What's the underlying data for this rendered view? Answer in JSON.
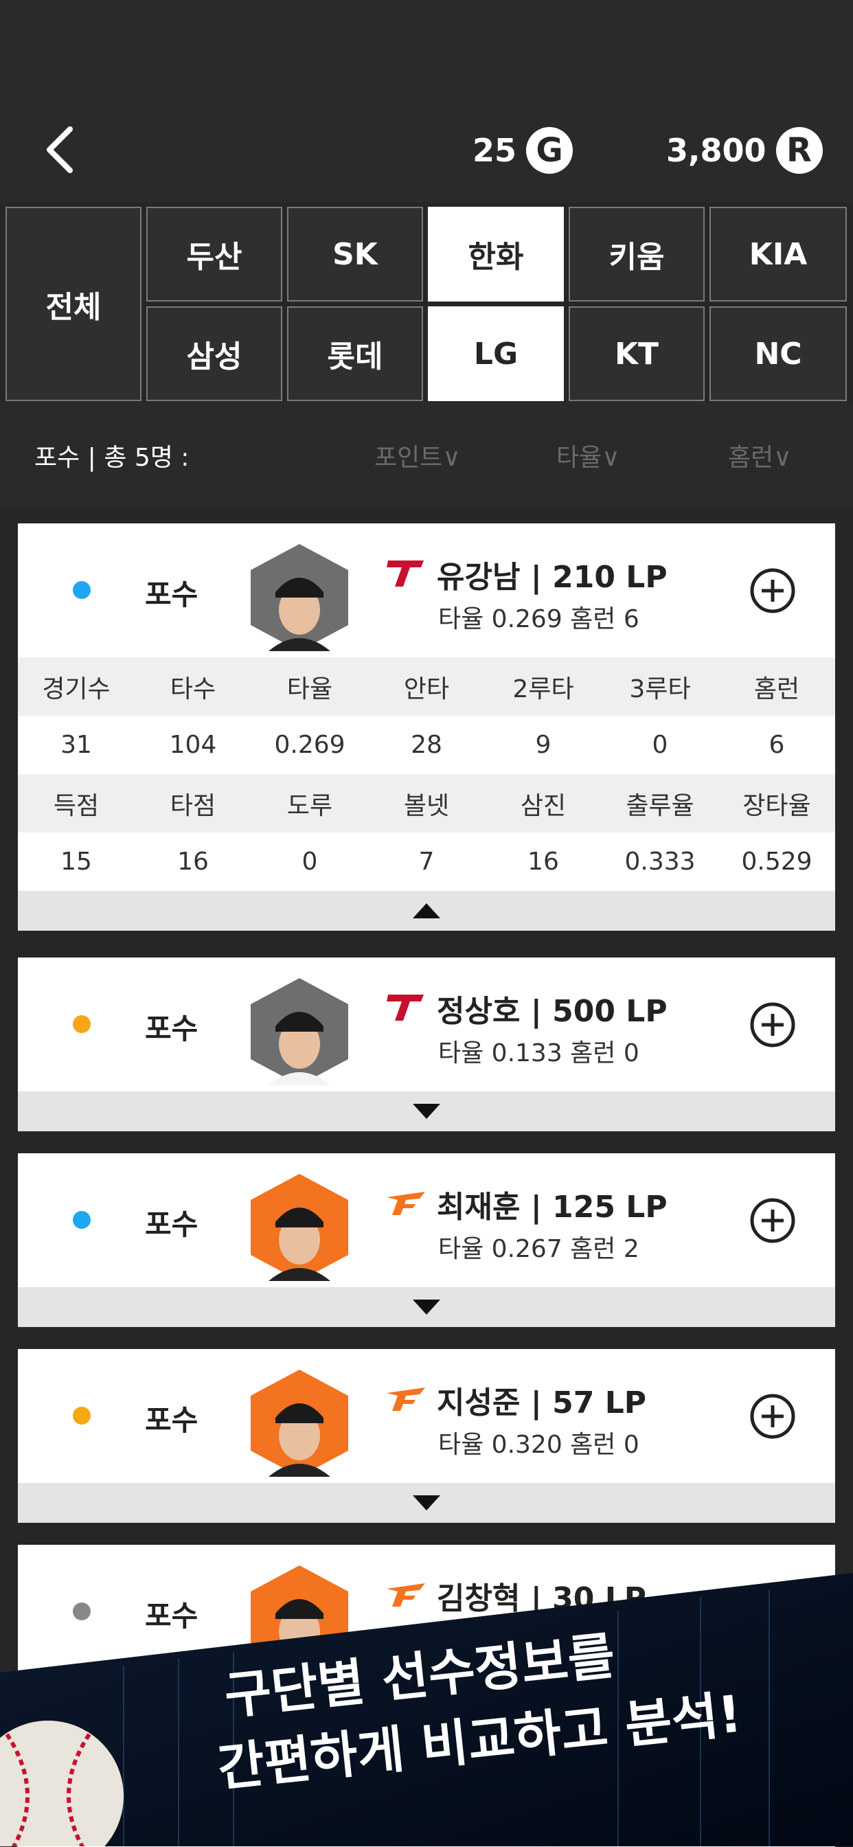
{
  "header": {
    "gold": "25",
    "gold_icon": "G",
    "ruby": "3,800",
    "ruby_icon": "R"
  },
  "teams": {
    "all": "전체",
    "row1": [
      "두산",
      "SK",
      "한화",
      "키움",
      "KIA"
    ],
    "row2": [
      "삼성",
      "롯데",
      "LG",
      "KT",
      "NC"
    ]
  },
  "list_header": {
    "count": "포수 | 총 5명 :",
    "sort_point": "포인트∨",
    "sort_avg": "타율∨",
    "sort_hr": "홈런∨"
  },
  "players": [
    {
      "position": "포수",
      "name": "유강남 | 210 LP",
      "sub": "타율 0.269 홈런 6",
      "dot": "#1ea7f0",
      "team_color": "#c8102e",
      "expanded": true,
      "stats_head1": [
        "경기수",
        "타수",
        "타율",
        "안타",
        "2루타",
        "3루타",
        "홈런"
      ],
      "stats_val1": [
        "31",
        "104",
        "0.269",
        "28",
        "9",
        "0",
        "6"
      ],
      "stats_head2": [
        "득점",
        "타점",
        "도루",
        "볼넷",
        "삼진",
        "출루율",
        "장타율"
      ],
      "stats_val2": [
        "15",
        "16",
        "0",
        "7",
        "16",
        "0.333",
        "0.529"
      ]
    },
    {
      "position": "포수",
      "name": "정상호 | 500 LP",
      "sub": "타율 0.133 홈런 0",
      "dot": "#f5a814",
      "team_color": "#c8102e",
      "expanded": false
    },
    {
      "position": "포수",
      "name": "최재훈 | 125 LP",
      "sub": "타율 0.267 홈런 2",
      "dot": "#1ea7f0",
      "team_color": "#f37321",
      "expanded": false
    },
    {
      "position": "포수",
      "name": "지성준 | 57 LP",
      "sub": "타율 0.320 홈런 0",
      "dot": "#f5a814",
      "team_color": "#f37321",
      "expanded": false
    },
    {
      "position": "포수",
      "name": "김창혁 | 30 LP",
      "sub": "",
      "dot": "#888888",
      "team_color": "#f37321",
      "expanded": false
    }
  ],
  "banner": {
    "line1": "구단별 선수정보를",
    "line2": "간편하게 비교하고 분석!"
  }
}
